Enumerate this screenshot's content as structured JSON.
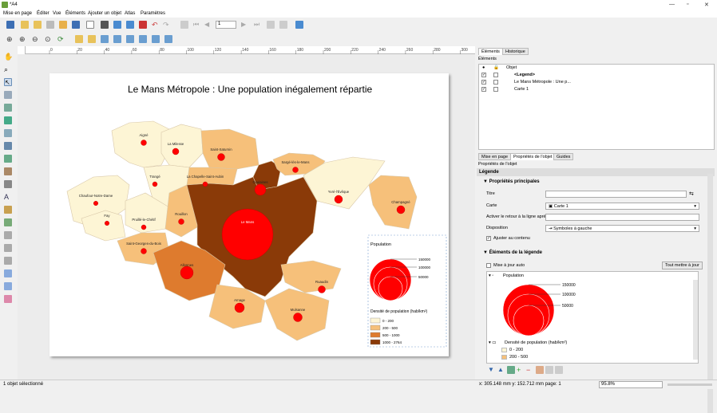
{
  "window": {
    "title": "*A4"
  },
  "menu": [
    "Mise en page",
    "Éditer",
    "Vue",
    "Éléments",
    "Ajouter un objet",
    "Atlas",
    "Paramètres"
  ],
  "toolbar": {
    "page_number": "1"
  },
  "ruler_ticks": [
    "0",
    "20",
    "40",
    "60",
    "80",
    "100",
    "120",
    "140",
    "160",
    "180",
    "200",
    "220",
    "240",
    "260",
    "280",
    "300"
  ],
  "map": {
    "title": "Le Mans Métropole : Une population inégalement répartie",
    "communes": [
      "Aigné",
      "La Milesse",
      "Saint-Saturnin",
      "Trangé",
      "La Chapelle-Saint-Aubin",
      "Coulaines",
      "Sargé-lès-le-Mans",
      "Yvré-l'Évêque",
      "Champagné",
      "Chaufour-Notre-Dame",
      "Fay",
      "Pruillé-le-Chétif",
      "Rouillon",
      "Le Mans",
      "Saint-Georges-du-Bois",
      "Allonnes",
      "Ruaudin",
      "Arnage",
      "Mulsanne"
    ]
  },
  "legend": {
    "population_title": "Population",
    "population_values": [
      "150000",
      "100000",
      "50000"
    ],
    "density_title": "Densité de population (hab/km²)",
    "density_classes": [
      "0 - 200",
      "200 - 500",
      "500 - 1000",
      "1000 - 2764"
    ],
    "density_colors": [
      "#fdf5d5",
      "#f6c07a",
      "#de7b2e",
      "#8a3a08"
    ]
  },
  "panel": {
    "tabs_top": [
      "Éléments",
      "Historique"
    ],
    "items_header": "Éléments",
    "items_col": "Objet",
    "items": [
      "<Legend>",
      "Le Mans Métropole : Une p...",
      "Carte 1"
    ],
    "tabs_mid": [
      "Mise en page",
      "Propriétés de l'objet",
      "Guides"
    ],
    "props_header": "Propriétés de l'objet",
    "props_type": "Légende",
    "main_props": "Propriétés principales",
    "titre_label": "Titre",
    "carte_label": "Carte",
    "carte_value": "Carte 1",
    "retour_label": "Activer le retour à la ligne après",
    "disposition_label": "Disposition",
    "disposition_value": "Symboles à gauche",
    "ajuster_label": "Ajuster au contenu",
    "legend_items": "Éléments de la légende",
    "maj_label": "Mise à jour auto",
    "tout_btn": "Tout mettre à jour",
    "tree_population": "Population",
    "tree_density": "Densité de population (hab/km²)",
    "tree_classes": [
      "0 - 200",
      "200 - 500"
    ]
  },
  "status": {
    "left": "1 objet sélectionné",
    "coords": "x: 305.148 mm   y: 152.712 mm   page: 1",
    "zoom": "95.8%"
  }
}
